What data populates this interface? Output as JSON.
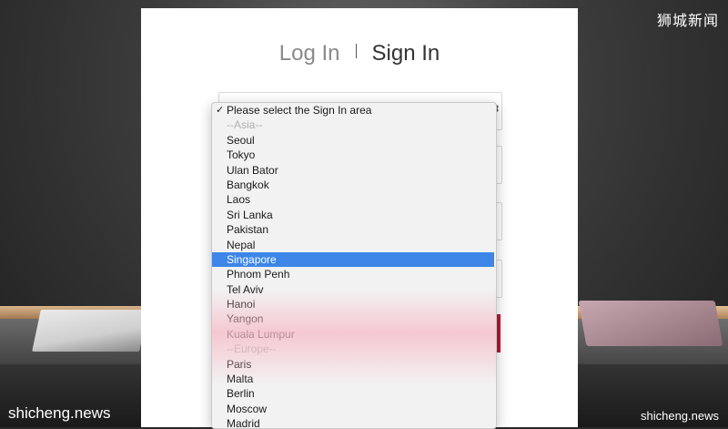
{
  "header": {
    "tab_login": "Log In",
    "tab_signin": "Sign In"
  },
  "area_select": {
    "selected_option": "Please select the Sign In area",
    "highlighted_option": "Singapore",
    "options": [
      {
        "label": "Please select the Sign In area",
        "kind": "option",
        "checked": true
      },
      {
        "label": "--Asia--",
        "kind": "group"
      },
      {
        "label": "Seoul",
        "kind": "option"
      },
      {
        "label": "Tokyo",
        "kind": "option"
      },
      {
        "label": "Ulan Bator",
        "kind": "option"
      },
      {
        "label": "Bangkok",
        "kind": "option"
      },
      {
        "label": "Laos",
        "kind": "option"
      },
      {
        "label": "Sri Lanka",
        "kind": "option"
      },
      {
        "label": "Pakistan",
        "kind": "option"
      },
      {
        "label": "Nepal",
        "kind": "option"
      },
      {
        "label": "Singapore",
        "kind": "option",
        "highlighted": true
      },
      {
        "label": "Phnom Penh",
        "kind": "option"
      },
      {
        "label": "Tel Aviv",
        "kind": "option"
      },
      {
        "label": "Hanoi",
        "kind": "option"
      },
      {
        "label": "Yangon",
        "kind": "option"
      },
      {
        "label": "Kuala Lumpur",
        "kind": "option"
      },
      {
        "label": "--Europe--",
        "kind": "group"
      },
      {
        "label": "Paris",
        "kind": "option"
      },
      {
        "label": "Malta",
        "kind": "option"
      },
      {
        "label": "Berlin",
        "kind": "option"
      },
      {
        "label": "Moscow",
        "kind": "option"
      },
      {
        "label": "Madrid",
        "kind": "option"
      }
    ]
  },
  "watermarks": {
    "top_right": "狮城新闻",
    "bottom_left": "shicheng.news",
    "bottom_right": "shicheng.news"
  },
  "colors": {
    "highlight": "#3d86e8",
    "brand_red": "#c8102e"
  }
}
